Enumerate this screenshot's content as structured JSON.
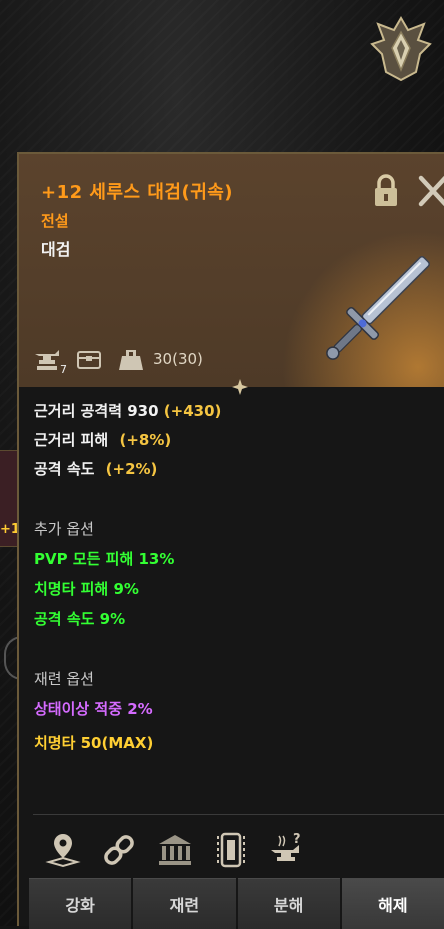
{
  "item": {
    "name": "+12 세루스 대검(귀속)",
    "grade": "전설",
    "type": "대검",
    "durability": "30(30)",
    "enhance_badge": "7"
  },
  "header_icons": [
    "anvil-icon",
    "chest-icon",
    "weight-icon"
  ],
  "base_stats": [
    {
      "label": "근거리 공격력 930",
      "bonus": "(+430)"
    },
    {
      "label": "근거리 피해",
      "bonus": "(+8%)"
    },
    {
      "label": "공격 속도",
      "bonus": "(+2%)"
    }
  ],
  "extra_options": {
    "title": "추가 옵션",
    "lines": [
      "PVP 모든 피해 13%",
      "치명타 피해 9%",
      "공격 속도 9%"
    ]
  },
  "refine_options": {
    "title": "재련 옵션",
    "lines": [
      "상태이상 적중 2%",
      "치명타 50(MAX)"
    ]
  },
  "bottom_icons": [
    "location-pin-icon",
    "link-icon",
    "bank-icon",
    "tablet-icon",
    "anvil-help-icon"
  ],
  "buttons": [
    "강화",
    "재련",
    "분해",
    "해제"
  ],
  "left_strip_label": "+1",
  "colors": {
    "item_name": "#ff9a1a",
    "bonus": "#f5c542",
    "extra_option": "#33ff33",
    "refine_option": "#d56bff",
    "max_option": "#ffcf33"
  }
}
